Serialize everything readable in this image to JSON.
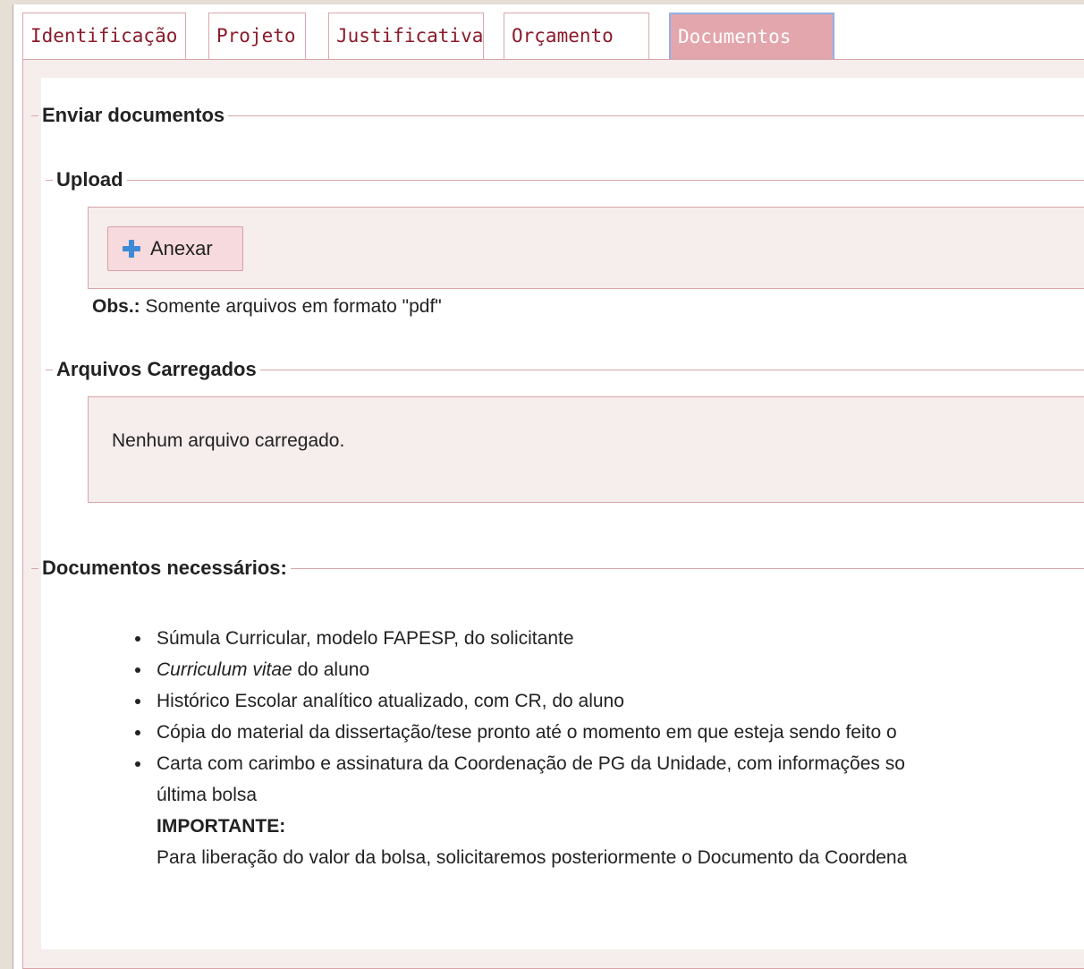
{
  "tabs": [
    {
      "label": "Identificação",
      "active": false
    },
    {
      "label": "Projeto",
      "active": false
    },
    {
      "label": "Justificativa",
      "active": false
    },
    {
      "label": "Orçamento",
      "active": false
    },
    {
      "label": "Documentos",
      "active": true
    }
  ],
  "sections": {
    "enviar": "Enviar documentos",
    "upload": "Upload",
    "arquivos": "Arquivos Carregados",
    "necessarios": "Documentos necessários:"
  },
  "upload": {
    "button_label": "Anexar",
    "button_icon": "plus-icon",
    "obs_label": "Obs.:",
    "obs_text": " Somente arquivos em formato \"pdf\""
  },
  "files": {
    "empty_message": "Nenhum arquivo carregado."
  },
  "documents": {
    "item1": "Súmula Curricular, modelo FAPESP, do solicitante",
    "item2_italic": "Curriculum vitae",
    "item2_rest": " do aluno",
    "item3": "Histórico Escolar analítico atualizado, com CR, do aluno",
    "item4": "Cópia do material da dissertação/tese pronto até o momento em que esteja sendo feito o",
    "item5_line1": "Carta com carimbo e assinatura da Coordenação de PG da Unidade, com informações so",
    "item5_line2": "última bolsa",
    "important_title": "IMPORTANTE:",
    "important_text": "Para liberação do valor da bolsa, solicitaremos posteriormente o Documento da Coordena"
  },
  "colors": {
    "accent": "#8b1a2a",
    "active_tab_bg": "#e3a6ad",
    "active_tab_border": "#8fb1e8",
    "panel_bg": "#f6eded",
    "border": "#d8a5a9",
    "button_icon": "#3e8ad6"
  }
}
